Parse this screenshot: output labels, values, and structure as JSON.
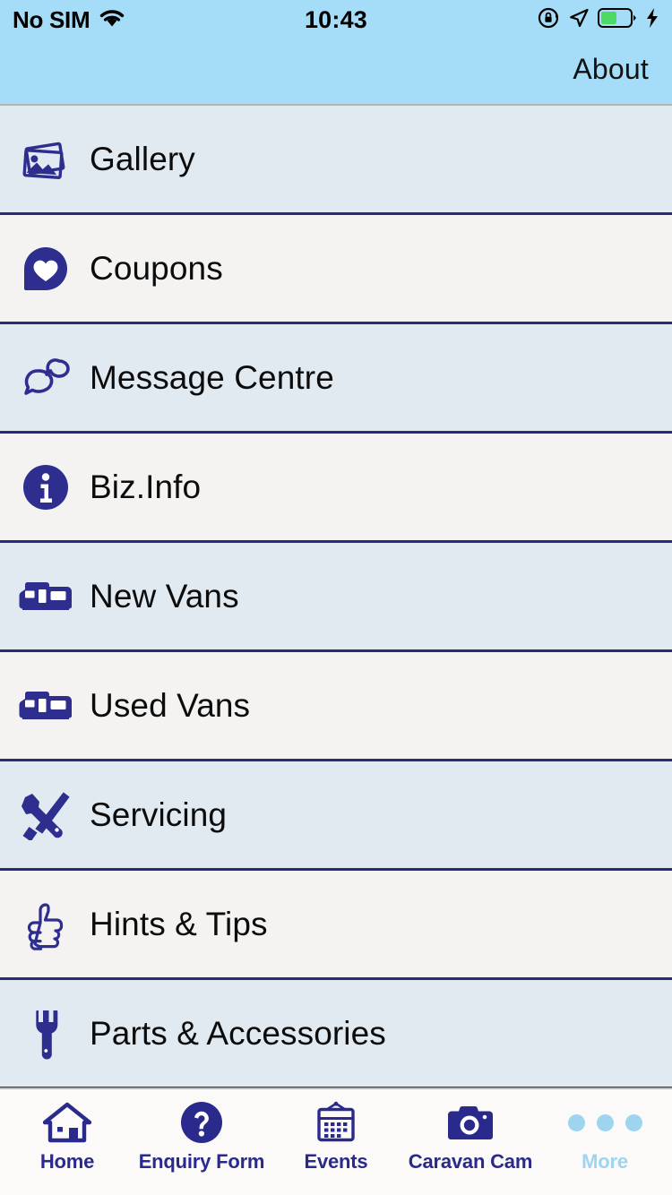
{
  "status_bar": {
    "carrier": "No SIM",
    "time": "10:43",
    "wifi_icon": "wifi-icon",
    "rotation_lock_icon": "rotation-lock-icon",
    "location_icon": "location-arrow-icon",
    "battery_icon": "battery-icon",
    "charging_icon": "lightning-bolt-icon",
    "battery_level_percent": 50
  },
  "nav_bar": {
    "about_label": "About"
  },
  "colors": {
    "header_bg": "#a5dcf7",
    "row_bg_a": "#e1e9f1",
    "row_bg_b": "#f4f3f2",
    "separator": "#2a2a7a",
    "icon_navy": "#2e2e8f",
    "tab_active": "#2a2a8c",
    "tab_inactive": "#9fd4f0",
    "tabbar_bg": "#fbfaf9",
    "battery_green": "#4cd964"
  },
  "menu": {
    "items": [
      {
        "label": "Gallery",
        "icon": "photos-stack-icon"
      },
      {
        "label": "Coupons",
        "icon": "pin-heart-icon"
      },
      {
        "label": "Message Centre",
        "icon": "speech-bubbles-icon"
      },
      {
        "label": "Biz.Info",
        "icon": "info-circle-icon"
      },
      {
        "label": "New Vans",
        "icon": "camper-van-icon"
      },
      {
        "label": "Used Vans",
        "icon": "camper-van-icon"
      },
      {
        "label": "Servicing",
        "icon": "wrench-screwdriver-icon"
      },
      {
        "label": "Hints & Tips",
        "icon": "thumbs-up-icon"
      },
      {
        "label": "Parts & Accessories",
        "icon": "wrench-icon"
      }
    ]
  },
  "tab_bar": {
    "tabs": [
      {
        "label": "Home",
        "icon": "house-icon",
        "state": "active"
      },
      {
        "label": "Enquiry Form",
        "icon": "question-circle-icon",
        "state": "active"
      },
      {
        "label": "Events",
        "icon": "calendar-icon",
        "state": "active"
      },
      {
        "label": "Caravan Cam",
        "icon": "camera-icon",
        "state": "active"
      },
      {
        "label": "More",
        "icon": "ellipsis-icon",
        "state": "inactive"
      }
    ]
  }
}
